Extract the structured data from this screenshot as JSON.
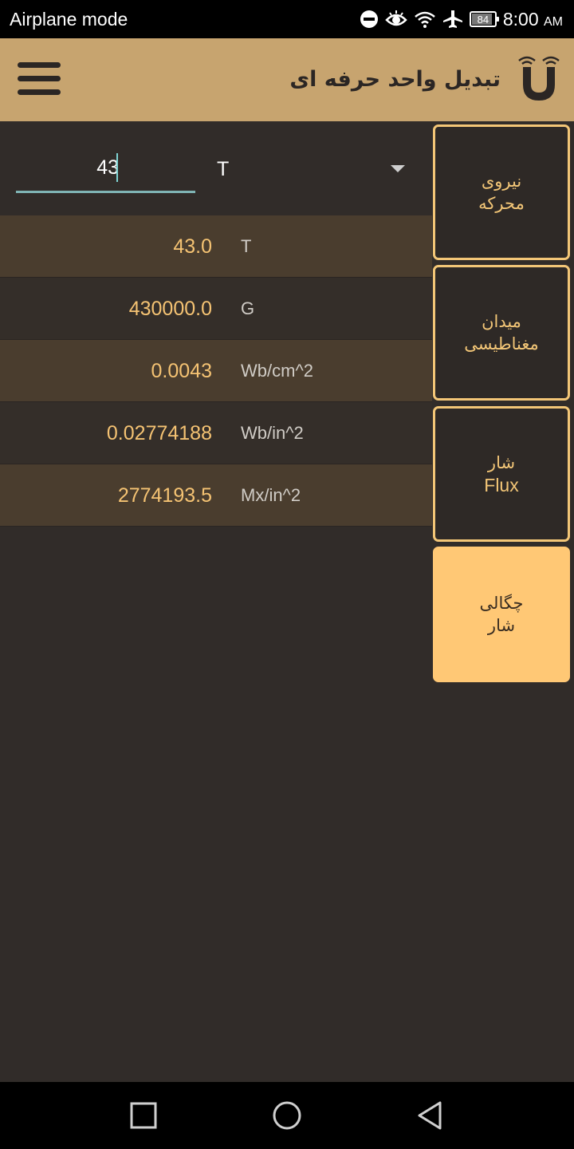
{
  "status_bar": {
    "left_text": "Airplane mode",
    "battery_level": "84",
    "time": "8:00",
    "time_suffix": "AM",
    "icons": [
      "do-not-disturb-icon",
      "eye-icon",
      "wifi-icon",
      "airplane-icon",
      "battery-icon"
    ]
  },
  "app_bar": {
    "title": "تبدیل واحد حرفه ای",
    "background": "#c7a46f",
    "menu_icon": "hamburger-menu-icon",
    "logo_icon": "magnet-icon"
  },
  "converter": {
    "input_value": "43",
    "selected_unit": "T",
    "accent": "#7fb4b4"
  },
  "results": [
    {
      "value": "43.0",
      "unit": "T"
    },
    {
      "value": "430000.0",
      "unit": "G"
    },
    {
      "value": "0.0043",
      "unit": "Wb/cm^2"
    },
    {
      "value": "0.02774188",
      "unit": "Wb/in^2"
    },
    {
      "value": "2774193.5",
      "unit": "Mx/in^2"
    }
  ],
  "categories": [
    {
      "line1": "نیروی",
      "line2": "محرکه",
      "active": false
    },
    {
      "line1": "میدان",
      "line2": "مغناطیسی",
      "active": false
    },
    {
      "line1": "شار",
      "line2": "Flux",
      "active": false
    },
    {
      "line1": "چگالی",
      "line2": "شار",
      "active": true
    }
  ],
  "colors": {
    "background": "#312c29",
    "value_text": "#f5c373",
    "button_border": "#f3c677",
    "button_active_bg": "#ffc875"
  },
  "nav_bar": {
    "icons": [
      "recents-square-icon",
      "home-circle-icon",
      "back-triangle-icon"
    ]
  }
}
